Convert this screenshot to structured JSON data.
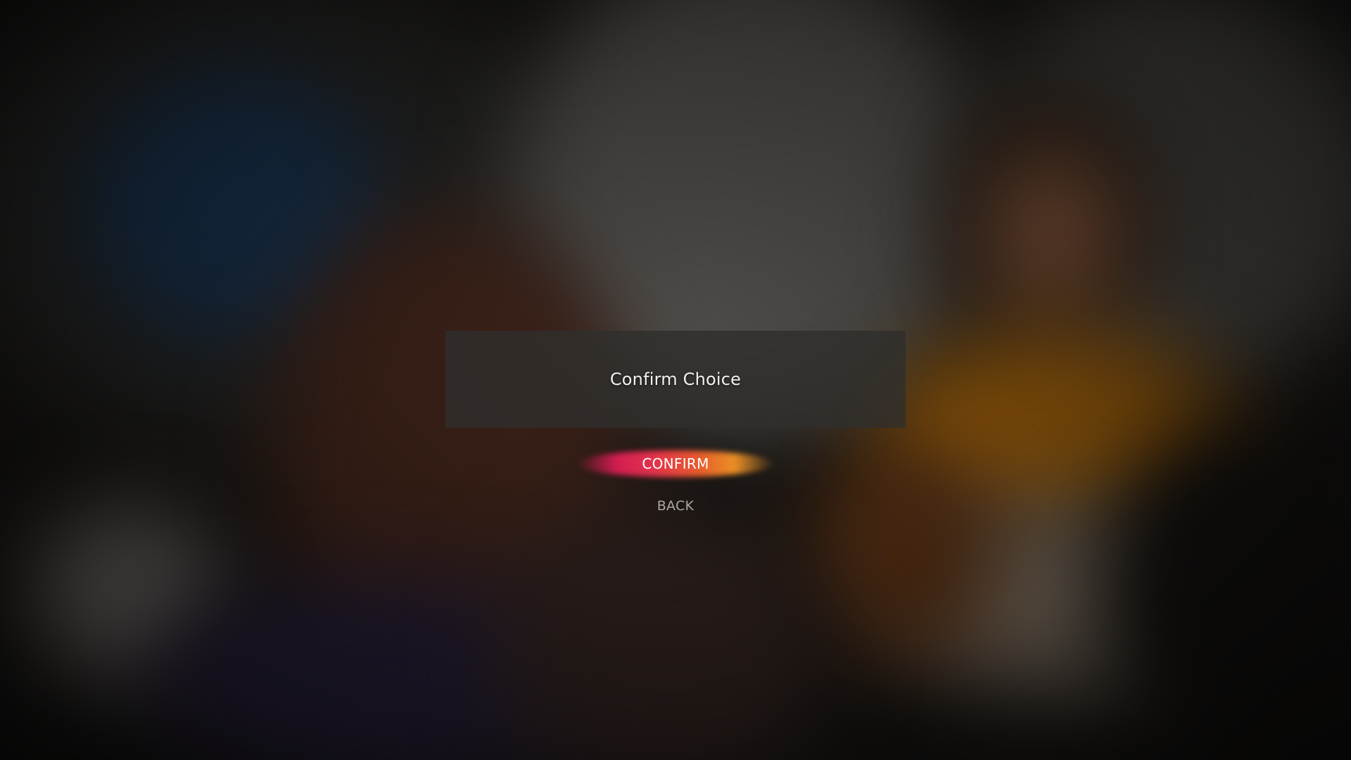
{
  "dialog": {
    "title": "Confirm Choice"
  },
  "buttons": {
    "confirm_label": "CONFIRM",
    "back_label": "BACK"
  },
  "colors": {
    "confirm_gradient_start": "#d21d52",
    "confirm_gradient_end": "#ea8f25",
    "dialog_bg": "#302e2c",
    "back_text": "#a9a6a3"
  }
}
